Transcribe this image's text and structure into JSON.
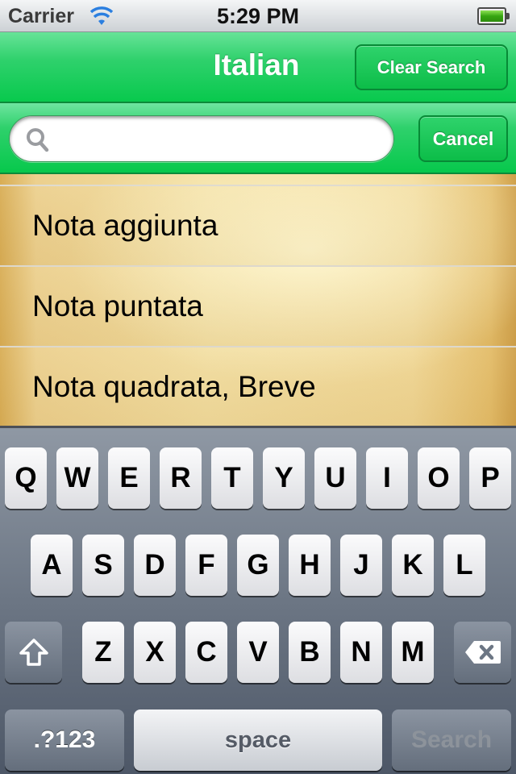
{
  "status_bar": {
    "carrier": "Carrier",
    "time": "5:29 PM",
    "wifi_icon": "wifi-icon",
    "battery_icon": "battery-full-icon"
  },
  "nav_bar": {
    "title": "Italian",
    "clear_search_label": "Clear Search"
  },
  "search_bar": {
    "value": "",
    "placeholder": "",
    "cancel_label": "Cancel",
    "search_icon": "magnifier-icon"
  },
  "list": {
    "items": [
      {
        "label": "Nota aggiunta"
      },
      {
        "label": "Nota puntata"
      },
      {
        "label": "Nota quadrata, Breve"
      }
    ]
  },
  "keyboard": {
    "row1": [
      "Q",
      "W",
      "E",
      "R",
      "T",
      "Y",
      "U",
      "I",
      "O",
      "P"
    ],
    "row2": [
      "A",
      "S",
      "D",
      "F",
      "G",
      "H",
      "J",
      "K",
      "L"
    ],
    "row3": [
      "Z",
      "X",
      "C",
      "V",
      "B",
      "N",
      "M"
    ],
    "numbers_label": ".?123",
    "space_label": "space",
    "search_label": "Search",
    "shift_icon": "shift-arrow-icon",
    "delete_icon": "backspace-icon"
  },
  "colors": {
    "nav_green": "#08c94d",
    "nav_green_light": "#67e398",
    "keyboard_bg": "#6c7684"
  }
}
